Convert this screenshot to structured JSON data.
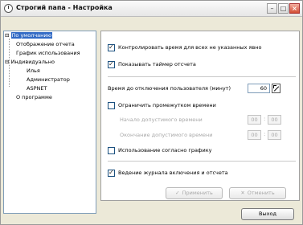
{
  "window": {
    "title": "Строгий папа - Настройка"
  },
  "tree": {
    "items": [
      {
        "label": "По умолчанию"
      },
      {
        "label": "Отображение отчета"
      },
      {
        "label": "График использования"
      },
      {
        "label": "Индивидуально"
      },
      {
        "label": "Илья"
      },
      {
        "label": "Администратор"
      },
      {
        "label": "ASPNET"
      },
      {
        "label": "О программе"
      }
    ]
  },
  "settings": {
    "control_time_label": "Контролировать время для всех не указанных явно",
    "show_timer_label": "Показывать таймер отсчета",
    "logout_time_label": "Время до отключения пользователя (минут)",
    "logout_time_value": "60",
    "limit_period_label": "Ограничить промежутком времени",
    "start_label": "Начало допустимого времени",
    "end_label": "Окончание допустимого времени",
    "start_hh": "00",
    "start_mm": "00",
    "end_hh": "00",
    "end_mm": "00",
    "use_schedule_label": "Использование согласно графику",
    "journal_label": "Ведение журнала включения и отсчета",
    "apply_label": "Применить",
    "cancel_label": "Отменить"
  },
  "footer": {
    "exit_label": "Выход"
  }
}
